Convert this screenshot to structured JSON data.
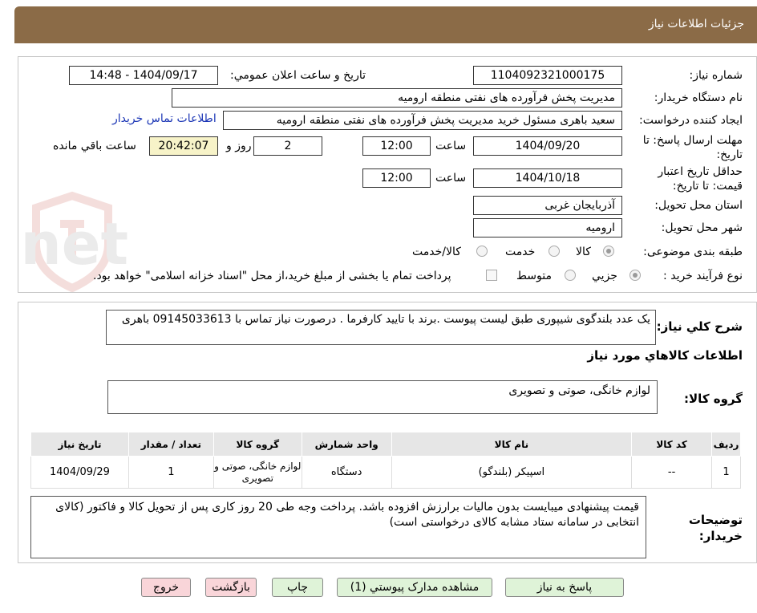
{
  "header": {
    "title": "جزئیات اطلاعات نیاز"
  },
  "info": {
    "need_number_label": "شماره نیاز:",
    "need_number": "1104092321000175",
    "announce_label": "تاریخ و ساعت اعلان عمومي:",
    "announce_value": "1404/09/17 - 14:48",
    "buyer_label": "نام دستگاه خريدار:",
    "buyer_value": "مدیریت پخش فرآورده های نفتی منطقه ارومیه",
    "creator_label": "ايجاد كننده درخواست:",
    "creator_value": "سعید باهری مسئول خرید مدیریت پخش فرآورده های نفتی منطقه ارومیه",
    "contact_link": "اطلاعات تماس خريدار",
    "deadline_label": "مهلت ارسال پاسخ: تا تاريخ:",
    "deadline_date": "1404/09/20",
    "time_label": "ساعت",
    "deadline_time": "12:00",
    "days_value": "2",
    "days_label": "روز و",
    "remaining_time": "20:42:07",
    "remaining_label": "ساعت باقي مانده",
    "validity_label": "حداقل تاريخ اعتبار قيمت: تا تاريخ:",
    "validity_date": "1404/10/18",
    "validity_time": "12:00",
    "province_label": "استان محل تحويل:",
    "province_value": "آذربايجان غربی",
    "city_label": "شهر محل تحويل:",
    "city_value": "ارومیه",
    "category_label": "طبقه بندی موضوعی:",
    "category_options": [
      "کالا",
      "خدمت",
      "کالا/خدمت"
    ],
    "process_label": "نوع فرآيند خريد :",
    "process_options": [
      "جزيي",
      "متوسط"
    ],
    "payment_note": "پرداخت تمام يا بخشی از مبلغ خريد،از محل \"اسناد خزانه اسلامی\" خواهد بود."
  },
  "description": {
    "label": "شرح كلي نياز:",
    "value": "یک عدد بلندگوی شیپوری طبق لیست پیوست .برند با تایید کارفرما . درصورت نیاز تماس با 09145033613 باهری"
  },
  "goods": {
    "section_title": "اطلاعات كالاهاي مورد نياز",
    "group_label": "گروه كالا:",
    "group_value": "لوازم خانگی، صوتی و تصویری",
    "columns": [
      "رديف",
      "کد کالا",
      "نام کالا",
      "واحد شمارش",
      "گروه کالا",
      "تعداد / مقدار",
      "تاريخ نياز"
    ],
    "rows": [
      {
        "index": "1",
        "code": "--",
        "name": "اسپیکر (بلندگو)",
        "unit": "دستگاه",
        "group": "لوازم خانگی، صوتی و تصویری",
        "qty": "1",
        "date": "1404/09/29"
      }
    ]
  },
  "buyer_notes": {
    "label": "توضيحات خريدار:",
    "value": "قیمت پیشنهادی میبایست بدون مالیات برارزش افزوده باشد. پرداخت وجه طی 20 روز کاری پس از تحویل کالا و فاکتور (کالای انتخابی در سامانه ستاد مشابه کالای درخواستی است)"
  },
  "buttons": {
    "reply": "پاسخ به نياز",
    "view_docs": "مشاهده مدارک پیوستي (1)",
    "print": "چاپ",
    "back": "بازگشت",
    "exit": "خروج"
  },
  "watermark": {
    "text": "AriaTender.net"
  },
  "colors": {
    "header": "#8b6b47",
    "link": "#1a35b5",
    "remaining_bg": "#f7f3c8",
    "green_btn": "#dff3d8",
    "pink_btn": "#f9d5d9"
  }
}
